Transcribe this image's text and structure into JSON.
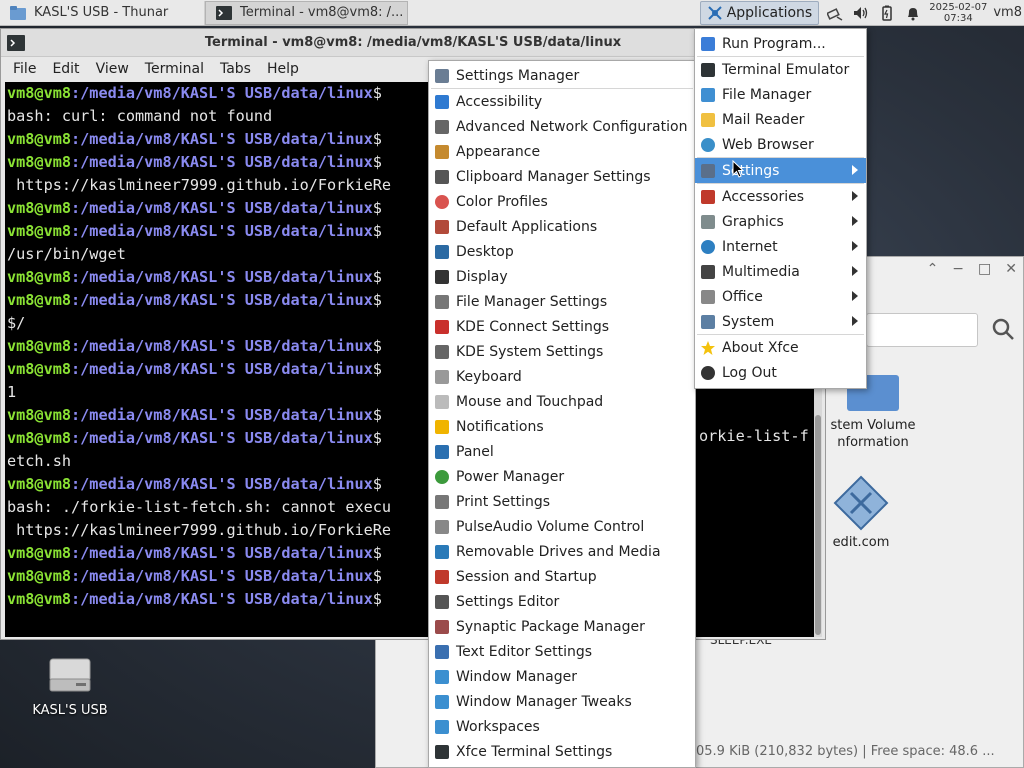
{
  "panel": {
    "tasks": [
      {
        "label": "KASL'S USB - Thunar"
      },
      {
        "label": "Terminal - vm8@vm8: /..."
      }
    ],
    "applications_label": "Applications",
    "clock": {
      "date": "2025-02-07",
      "time": "07:34"
    },
    "user": "vm8"
  },
  "terminal": {
    "title": "Terminal - vm8@vm8: /media/vm8/KASL'S USB/data/linux",
    "menu": [
      "File",
      "Edit",
      "View",
      "Terminal",
      "Tabs",
      "Help"
    ],
    "prompt_user": "vm8@vm8",
    "prompt_path": ":/media/vm8/KASL'S USB/data/linux",
    "prompt_end": "$ ",
    "lines": [
      {
        "prompt": true,
        "text": ""
      },
      {
        "prompt": false,
        "text": "bash: curl: command not found"
      },
      {
        "prompt": true,
        "text": ""
      },
      {
        "prompt": true,
        "text": ""
      },
      {
        "prompt": false,
        "text": " https://kaslmineer7999.github.io/ForkieRe"
      },
      {
        "prompt": true,
        "text": ""
      },
      {
        "prompt": true,
        "text": ""
      },
      {
        "prompt": false,
        "text": "/usr/bin/wget"
      },
      {
        "prompt": true,
        "text": ""
      },
      {
        "prompt": true,
        "text": ""
      },
      {
        "prompt": false,
        "text": "$/"
      },
      {
        "prompt": true,
        "text": ""
      },
      {
        "prompt": true,
        "text": ""
      },
      {
        "prompt": false,
        "text": "1"
      },
      {
        "prompt": true,
        "text": ""
      },
      {
        "prompt": true,
        "text": ""
      },
      {
        "prompt": false,
        "text": "etch.sh"
      },
      {
        "prompt": true,
        "text": ""
      },
      {
        "prompt": false,
        "text": "bash: ./forkie-list-fetch.sh: cannot execu"
      },
      {
        "prompt": false,
        "text": " https://kaslmineer7999.github.io/ForkieRe"
      },
      {
        "prompt": true,
        "text": ""
      },
      {
        "prompt": true,
        "text": ""
      },
      {
        "prompt": true,
        "text": ""
      }
    ],
    "hidden_right_text": "orkie-list-f"
  },
  "thunar": {
    "files": [
      {
        "name": "stem Volume\nnformation"
      },
      {
        "name": "edit.com"
      },
      {
        "name": "SLEEP.EXE"
      }
    ],
    "status": "05.9 KiB (210,832 bytes)  |  Free space: 48.6 ..."
  },
  "desktop": {
    "usb_label": "KASL'S USB"
  },
  "apps_menu": {
    "items": [
      {
        "label": "Run Program...",
        "icon": "run-icon",
        "submenu": false
      },
      "sep",
      {
        "label": "Terminal Emulator",
        "icon": "terminal-icon",
        "submenu": false
      },
      {
        "label": "File Manager",
        "icon": "folder-icon",
        "submenu": false
      },
      {
        "label": "Mail Reader",
        "icon": "mail-icon",
        "submenu": false
      },
      {
        "label": "Web Browser",
        "icon": "globe-icon",
        "submenu": false
      },
      "sep",
      {
        "label": "Settings",
        "icon": "settings-icon",
        "submenu": true,
        "selected": true
      },
      "sep",
      {
        "label": "Accessories",
        "icon": "accessories-icon",
        "submenu": true
      },
      {
        "label": "Graphics",
        "icon": "graphics-icon",
        "submenu": true
      },
      {
        "label": "Internet",
        "icon": "internet-icon",
        "submenu": true
      },
      {
        "label": "Multimedia",
        "icon": "multimedia-icon",
        "submenu": true
      },
      {
        "label": "Office",
        "icon": "office-icon",
        "submenu": true
      },
      {
        "label": "System",
        "icon": "system-icon",
        "submenu": true
      },
      "sep",
      {
        "label": "About Xfce",
        "icon": "star-icon",
        "submenu": false
      },
      {
        "label": "Log Out",
        "icon": "logout-icon",
        "submenu": false
      }
    ]
  },
  "settings_menu": {
    "items": [
      {
        "label": "Settings Manager",
        "icon": "settings-manager-icon"
      },
      "sep",
      {
        "label": "Accessibility",
        "icon": "accessibility-icon"
      },
      {
        "label": "Advanced Network Configuration",
        "icon": "network-icon"
      },
      {
        "label": "Appearance",
        "icon": "appearance-icon"
      },
      {
        "label": "Clipboard Manager Settings",
        "icon": "clipboard-icon"
      },
      {
        "label": "Color Profiles",
        "icon": "color-profiles-icon"
      },
      {
        "label": "Default Applications",
        "icon": "default-apps-icon"
      },
      {
        "label": "Desktop",
        "icon": "desktop-icon"
      },
      {
        "label": "Display",
        "icon": "display-icon"
      },
      {
        "label": "File Manager Settings",
        "icon": "file-manager-settings-icon"
      },
      {
        "label": "KDE Connect Settings",
        "icon": "kde-connect-icon"
      },
      {
        "label": "KDE System Settings",
        "icon": "kde-settings-icon"
      },
      {
        "label": "Keyboard",
        "icon": "keyboard-icon"
      },
      {
        "label": "Mouse and Touchpad",
        "icon": "mouse-icon"
      },
      {
        "label": "Notifications",
        "icon": "bell-icon"
      },
      {
        "label": "Panel",
        "icon": "panel-icon"
      },
      {
        "label": "Power Manager",
        "icon": "power-icon"
      },
      {
        "label": "Print Settings",
        "icon": "printer-icon"
      },
      {
        "label": "PulseAudio Volume Control",
        "icon": "audio-icon"
      },
      {
        "label": "Removable Drives and Media",
        "icon": "removable-drive-icon"
      },
      {
        "label": "Session and Startup",
        "icon": "session-icon"
      },
      {
        "label": "Settings Editor",
        "icon": "settings-editor-icon"
      },
      {
        "label": "Synaptic Package Manager",
        "icon": "package-icon"
      },
      {
        "label": "Text Editor Settings",
        "icon": "text-editor-icon"
      },
      {
        "label": "Window Manager",
        "icon": "window-manager-icon"
      },
      {
        "label": "Window Manager Tweaks",
        "icon": "wm-tweaks-icon"
      },
      {
        "label": "Workspaces",
        "icon": "workspaces-icon"
      },
      {
        "label": "Xfce Terminal Settings",
        "icon": "terminal-settings-icon"
      }
    ]
  },
  "colors": {
    "accent": "#4a90d9",
    "prompt_user": "#8ae234",
    "prompt_path": "#8a8af0",
    "terminal_bg": "#000000"
  }
}
